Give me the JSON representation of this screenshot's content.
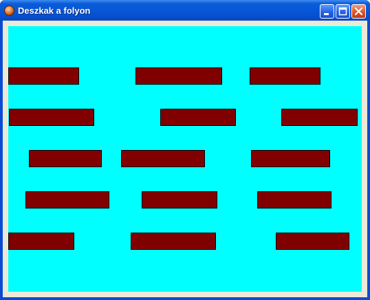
{
  "window": {
    "title": "Deszkak a folyon",
    "icon": "app-icon"
  },
  "title_buttons": {
    "minimize_icon": "minimize-icon",
    "maximize_icon": "maximize-icon",
    "close_icon": "close-icon"
  },
  "colors": {
    "river": "#00ffff",
    "plank": "#800000",
    "plank_border": "#000000",
    "frame": "#ece9d8"
  },
  "planks": {
    "rows": 5,
    "per_row": 3,
    "count": 15
  }
}
